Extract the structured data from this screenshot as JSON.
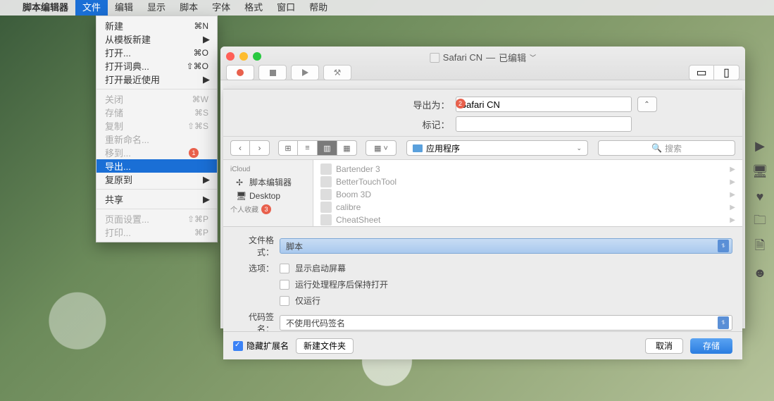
{
  "menubar": {
    "app": "脚本编辑器",
    "items": [
      "文件",
      "编辑",
      "显示",
      "脚本",
      "字体",
      "格式",
      "窗口",
      "帮助"
    ]
  },
  "file_menu": {
    "new": "新建",
    "new_sc": "⌘N",
    "new_from_template": "从模板新建",
    "open": "打开...",
    "open_sc": "⌘O",
    "open_dict": "打开词典...",
    "open_dict_sc": "⇧⌘O",
    "open_recent": "打开最近使用",
    "close": "关闭",
    "close_sc": "⌘W",
    "save": "存储",
    "save_sc": "⌘S",
    "duplicate": "复制",
    "duplicate_sc": "⇧⌘S",
    "rename": "重新命名...",
    "moveto": "移到...",
    "export": "导出...",
    "revert": "复原到",
    "share": "共享",
    "page_setup": "页面设置...",
    "page_setup_sc": "⇧⌘P",
    "print": "打印...",
    "print_sc": "⌘P"
  },
  "badges": {
    "one": "1",
    "two": "2",
    "three": "3"
  },
  "window": {
    "title": "Safari CN",
    "state": "已编辑"
  },
  "sheet": {
    "export_label": "导出为：",
    "export_name": "Safari CN",
    "tag_label": "标记：",
    "location": "应用程序",
    "search_placeholder": "搜索",
    "sidebar": {
      "icloud_header": "iCloud",
      "script_editor": "脚本编辑器",
      "desktop": "Desktop",
      "fav_header": "个人收藏"
    },
    "files": [
      "Bartender 3",
      "BetterTouchTool",
      "Boom 3D",
      "calibre",
      "CheatSheet"
    ],
    "format_label": "文件格式：",
    "format_value": "脚本",
    "options_label": "选项：",
    "opt_show_startup": "显示启动屏幕",
    "opt_stay_open": "运行处理程序后保持打开",
    "opt_run_only": "仅运行",
    "codesign_label": "代码签名：",
    "codesign_value": "不使用代码签名",
    "hide_ext": "隐藏扩展名",
    "new_folder": "新建文件夹",
    "cancel": "取消",
    "save": "存储"
  }
}
